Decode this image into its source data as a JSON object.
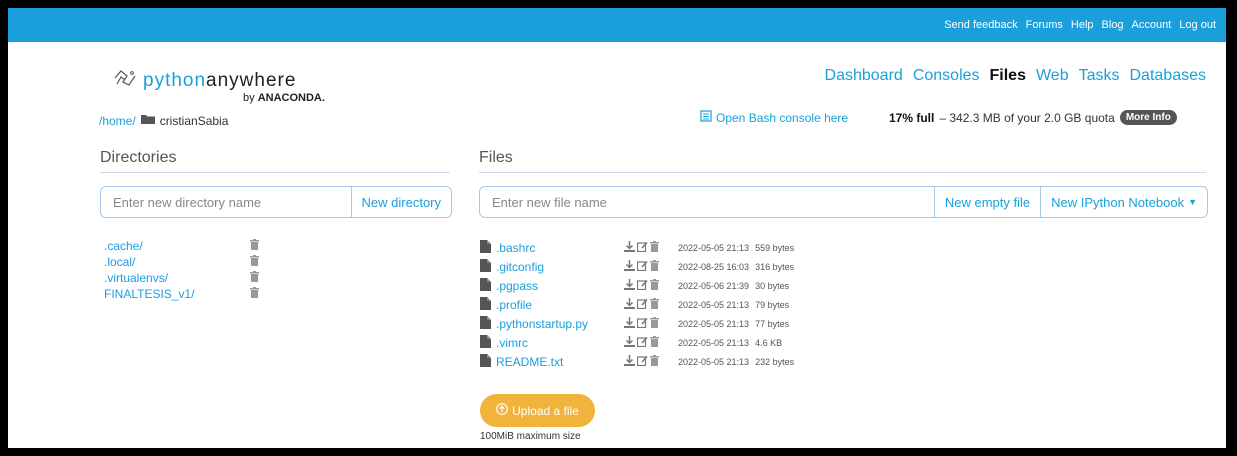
{
  "topbar": {
    "links": [
      "Send feedback",
      "Forums",
      "Help",
      "Blog",
      "Account",
      "Log out"
    ]
  },
  "logo": {
    "text_python": "python",
    "text_anywhere": "anywhere",
    "byline_prefix": "by",
    "byline_brand": "ANACONDA."
  },
  "breadcrumb": {
    "home": "/home/",
    "current": "cristianSabia"
  },
  "nav": {
    "items": [
      "Dashboard",
      "Consoles",
      "Files",
      "Web",
      "Tasks",
      "Databases"
    ],
    "active": "Files"
  },
  "bash_console": "Open Bash console here",
  "quota": {
    "percent": "17% full",
    "text": "– 342.3 MB of your 2.0 GB quota",
    "more_info": "More Info"
  },
  "directories": {
    "title": "Directories",
    "input_placeholder": "Enter new directory name",
    "button": "New directory",
    "items": [
      ".cache/",
      ".local/",
      ".virtualenvs/",
      "FINALTESIS_v1/"
    ]
  },
  "files": {
    "title": "Files",
    "input_placeholder": "Enter new file name",
    "new_empty_file": "New empty file",
    "new_notebook": "New IPython Notebook",
    "items": [
      {
        "name": ".bashrc",
        "date": "2022-05-05 21:13",
        "size": "559 bytes"
      },
      {
        "name": ".gitconfig",
        "date": "2022-08-25 16:03",
        "size": "316 bytes"
      },
      {
        "name": ".pgpass",
        "date": "2022-05-06 21:39",
        "size": "30 bytes"
      },
      {
        "name": ".profile",
        "date": "2022-05-05 21:13",
        "size": "79 bytes"
      },
      {
        "name": ".pythonstartup.py",
        "date": "2022-05-05 21:13",
        "size": "77 bytes"
      },
      {
        "name": ".vimrc",
        "date": "2022-05-05 21:13",
        "size": "4.6 KB"
      },
      {
        "name": "README.txt",
        "date": "2022-05-05 21:13",
        "size": "232 bytes"
      }
    ]
  },
  "upload": {
    "button": "Upload a file",
    "note": "100MiB maximum size"
  },
  "colors": {
    "brand": "#1a9fdd",
    "upload": "#f0b33c"
  }
}
